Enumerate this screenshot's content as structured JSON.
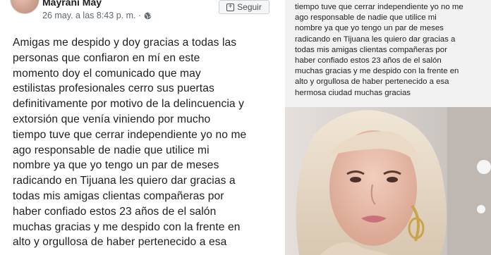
{
  "post": {
    "author": "Mayrani May",
    "timestamp": "26 may. a las 8:43 p. m. ·",
    "follow_label": "Seguir",
    "lines": [
      "Amigas me despido y doy gracias a todas las",
      "personas que confiaron en mí en este",
      "momento doy el comunicado que may",
      "estilistas profesionales cerro sus puertas",
      "definitivamente por motivo de la delincuencia y",
      "extorsión que venía viniendo por mucho",
      "tiempo tuve que cerrar independiente yo no me",
      "ago responsable de nadie que utilice mi",
      "nombre ya que yo tengo un par de meses",
      "radicando en Tijuana les quiero dar gracias a",
      "todas mis amigas clientas compañeras por",
      "haber confiado estos 23 años de el salón",
      "muchas gracias y me despido con la frente en",
      "alto y orgullosa de haber pertenecido a esa"
    ]
  },
  "right_post": {
    "lines": [
      "tiempo tuve que cerrar independiente yo no me",
      "ago responsable de nadie que utilice mi",
      "nombre ya que yo tengo un par de meses",
      "radicando en Tijuana les quiero dar gracias a",
      "todas mis amigas clientas compañeras por",
      "haber confiado estos 23 años de el salón",
      "muchas gracias y me despido con la frente en",
      "alto y orgullosa de haber pertenecido a esa",
      "hermosa ciudad muchas gracias"
    ]
  },
  "icons": {
    "globe": "globe-icon",
    "follow": "plus-square-icon"
  },
  "colors": {
    "text": "#1c1e21",
    "meta": "#606770",
    "button_border": "#ccd0d5"
  }
}
